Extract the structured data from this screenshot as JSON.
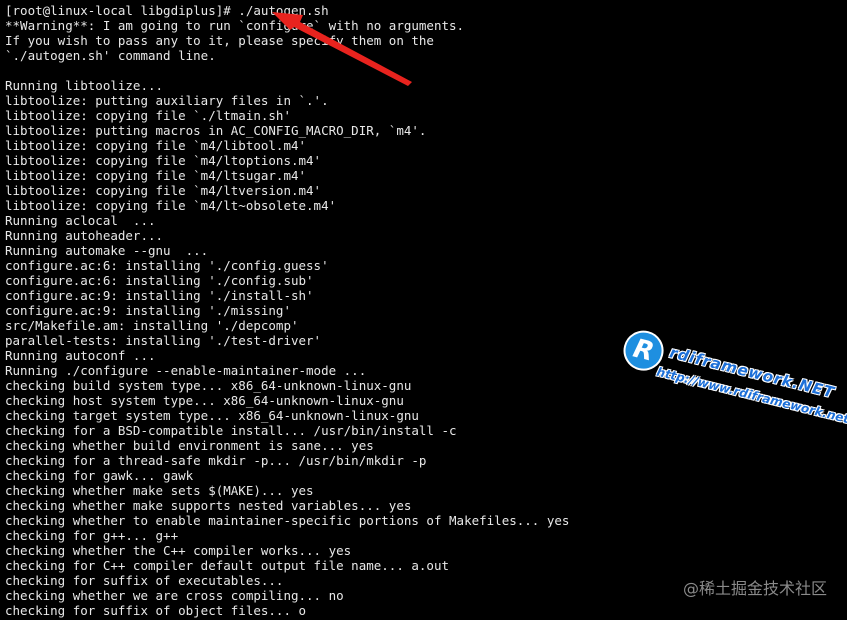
{
  "terminal": {
    "lines": [
      "[root@linux-local libgdiplus]# ./autogen.sh",
      "**Warning**: I am going to run `configure` with no arguments.",
      "If you wish to pass any to it, please specify them on the",
      "`./autogen.sh' command line.",
      "",
      "Running libtoolize...",
      "libtoolize: putting auxiliary files in `.'.",
      "libtoolize: copying file `./ltmain.sh'",
      "libtoolize: putting macros in AC_CONFIG_MACRO_DIR, `m4'.",
      "libtoolize: copying file `m4/libtool.m4'",
      "libtoolize: copying file `m4/ltoptions.m4'",
      "libtoolize: copying file `m4/ltsugar.m4'",
      "libtoolize: copying file `m4/ltversion.m4'",
      "libtoolize: copying file `m4/lt~obsolete.m4'",
      "Running aclocal  ...",
      "Running autoheader...",
      "Running automake --gnu  ...",
      "configure.ac:6: installing './config.guess'",
      "configure.ac:6: installing './config.sub'",
      "configure.ac:9: installing './install-sh'",
      "configure.ac:9: installing './missing'",
      "src/Makefile.am: installing './depcomp'",
      "parallel-tests: installing './test-driver'",
      "Running autoconf ...",
      "Running ./configure --enable-maintainer-mode ...",
      "checking build system type... x86_64-unknown-linux-gnu",
      "checking host system type... x86_64-unknown-linux-gnu",
      "checking target system type... x86_64-unknown-linux-gnu",
      "checking for a BSD-compatible install... /usr/bin/install -c",
      "checking whether build environment is sane... yes",
      "checking for a thread-safe mkdir -p... /usr/bin/mkdir -p",
      "checking for gawk... gawk",
      "checking whether make sets $(MAKE)... yes",
      "checking whether make supports nested variables... yes",
      "checking whether to enable maintainer-specific portions of Makefiles... yes",
      "checking for g++... g++",
      "checking whether the C++ compiler works... yes",
      "checking for C++ compiler default output file name... a.out",
      "checking for suffix of executables...",
      "checking whether we are cross compiling... no",
      "checking for suffix of object files... o"
    ]
  },
  "logo": {
    "letter": "R",
    "name": "rdiframework.NET",
    "url": "http://www.rdiframework.net"
  },
  "watermark": {
    "text": "@稀土掘金技术社区"
  },
  "colors": {
    "background": "#000000",
    "text": "#e8e8e8",
    "arrow": "#e8231e",
    "logo_blue": "#1e8fe0"
  }
}
